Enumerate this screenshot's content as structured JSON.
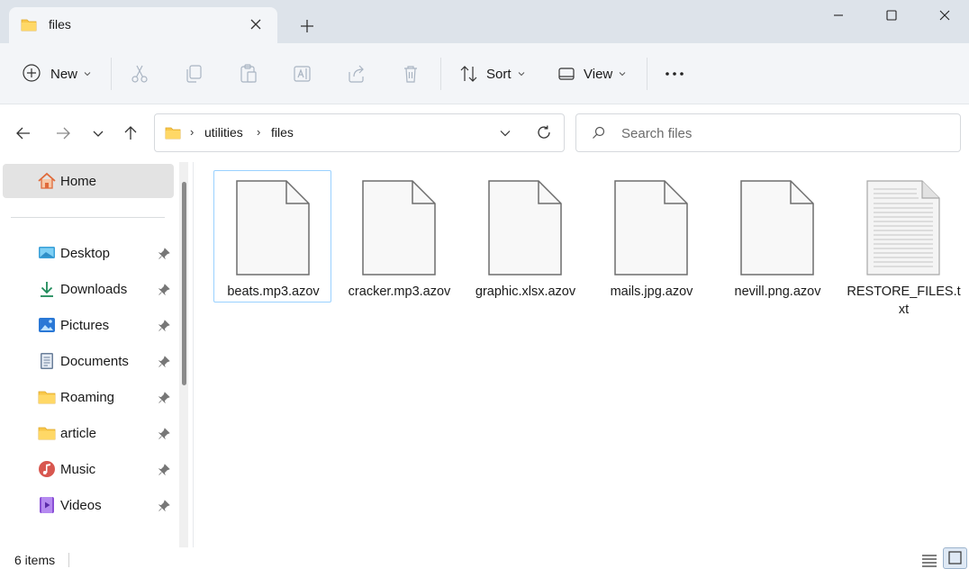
{
  "window": {
    "tab_title": "files",
    "tab_icon": "folder-icon",
    "controls": [
      "minimize-icon",
      "maximize-icon",
      "close-icon"
    ]
  },
  "toolbar": {
    "new_label": "New",
    "sort_label": "Sort",
    "view_label": "View",
    "actions": [
      "cut-icon",
      "copy-icon",
      "paste-icon",
      "rename-icon",
      "share-icon",
      "delete-icon",
      "more-icon"
    ]
  },
  "address": {
    "crumbs": [
      "utilities",
      "files"
    ]
  },
  "search": {
    "placeholder": "Search files"
  },
  "sidebar": {
    "home_label": "Home",
    "items": [
      {
        "label": "Desktop",
        "icon": "desktop-icon"
      },
      {
        "label": "Downloads",
        "icon": "download-icon"
      },
      {
        "label": "Pictures",
        "icon": "pictures-icon"
      },
      {
        "label": "Documents",
        "icon": "documents-icon"
      },
      {
        "label": "Roaming",
        "icon": "folder-icon"
      },
      {
        "label": "article",
        "icon": "folder-icon"
      },
      {
        "label": "Music",
        "icon": "music-icon"
      },
      {
        "label": "Videos",
        "icon": "videos-icon"
      }
    ]
  },
  "files": [
    {
      "name": "beats.mp3.azov",
      "icon": "blank-file-icon",
      "selected": true
    },
    {
      "name": "cracker.mp3.azov",
      "icon": "blank-file-icon",
      "selected": false
    },
    {
      "name": "graphic.xlsx.azov",
      "icon": "blank-file-icon",
      "selected": false
    },
    {
      "name": "mails.jpg.azov",
      "icon": "blank-file-icon",
      "selected": false
    },
    {
      "name": "nevill.png.azov",
      "icon": "blank-file-icon",
      "selected": false
    },
    {
      "name": "RESTORE_FILES.txt",
      "icon": "text-file-icon",
      "selected": false
    }
  ],
  "status": {
    "item_count": "6 items"
  },
  "colors": {
    "titlebar": "#dde3ea",
    "toolbar": "#f3f5f8",
    "folder_yellow": "#f8c74a",
    "selection_border": "#99d1ff"
  }
}
